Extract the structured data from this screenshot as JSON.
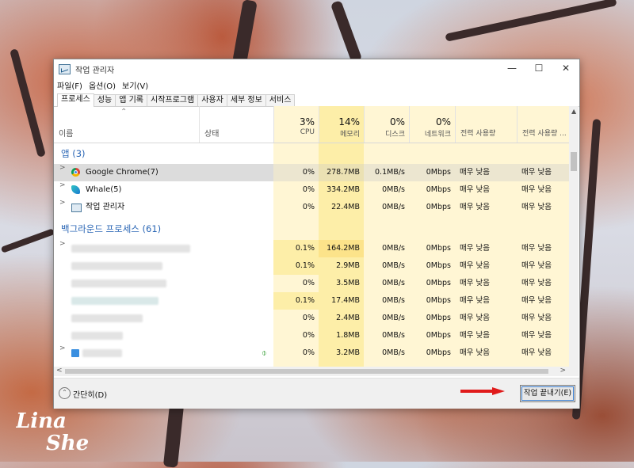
{
  "window": {
    "title": "작업 관리자",
    "controls": {
      "minimize": "—",
      "maximize": "☐",
      "close": "✕"
    }
  },
  "menu": [
    "파일(F)",
    "옵션(O)",
    "보기(V)"
  ],
  "tabs": [
    "프로세스",
    "성능",
    "앱 기록",
    "시작프로그램",
    "사용자",
    "세부 정보",
    "서비스"
  ],
  "columns": {
    "name": "이름",
    "status": "상태",
    "cpu": {
      "pct": "3%",
      "label": "CPU"
    },
    "memory": {
      "pct": "14%",
      "label": "메모리"
    },
    "disk": {
      "pct": "0%",
      "label": "디스크"
    },
    "network": {
      "pct": "0%",
      "label": "네트워크"
    },
    "power": "전력 사용량",
    "power_trend": "전력 사용량 ..."
  },
  "sections": {
    "apps": "앱 (3)",
    "background": "백그라운드 프로세스 (61)"
  },
  "apps": [
    {
      "name": "Google Chrome(7)",
      "cpu": "0%",
      "mem": "278.7MB",
      "disk": "0.1MB/s",
      "net": "0Mbps",
      "power": "매우 낮음",
      "trend": "매우 낮음"
    },
    {
      "name": "Whale(5)",
      "cpu": "0%",
      "mem": "334.2MB",
      "disk": "0MB/s",
      "net": "0Mbps",
      "power": "매우 낮음",
      "trend": "매우 낮음"
    },
    {
      "name": "작업 관리자",
      "cpu": "0%",
      "mem": "22.4MB",
      "disk": "0MB/s",
      "net": "0Mbps",
      "power": "매우 낮음",
      "trend": "매우 낮음"
    }
  ],
  "background": [
    {
      "cpu": "0.1%",
      "mem": "164.2MB",
      "disk": "0MB/s",
      "net": "0Mbps",
      "power": "매우 낮음",
      "trend": "매우 낮음"
    },
    {
      "cpu": "0.1%",
      "mem": "2.9MB",
      "disk": "0MB/s",
      "net": "0Mbps",
      "power": "매우 낮음",
      "trend": "매우 낮음"
    },
    {
      "cpu": "0%",
      "mem": "3.5MB",
      "disk": "0MB/s",
      "net": "0Mbps",
      "power": "매우 낮음",
      "trend": "매우 낮음"
    },
    {
      "cpu": "0.1%",
      "mem": "17.4MB",
      "disk": "0MB/s",
      "net": "0Mbps",
      "power": "매우 낮음",
      "trend": "매우 낮음"
    },
    {
      "cpu": "0%",
      "mem": "2.4MB",
      "disk": "0MB/s",
      "net": "0Mbps",
      "power": "매우 낮음",
      "trend": "매우 낮음"
    },
    {
      "cpu": "0%",
      "mem": "1.8MB",
      "disk": "0MB/s",
      "net": "0Mbps",
      "power": "매우 낮음",
      "trend": "매우 낮음"
    },
    {
      "cpu": "0%",
      "mem": "3.2MB",
      "disk": "0MB/s",
      "net": "0Mbps",
      "power": "매우 낮음",
      "trend": "매우 낮음"
    }
  ],
  "footer": {
    "fewer_details": "간단히(D)",
    "end_task": "작업 끝내기(E)"
  },
  "watermark": "Lina She",
  "colors": {
    "accent": "#2a66b5",
    "heat_light": "#fff6d4",
    "heat_mid": "#fdeea8",
    "heat_strong": "#fce38a",
    "arrow": "#e01b1b"
  }
}
